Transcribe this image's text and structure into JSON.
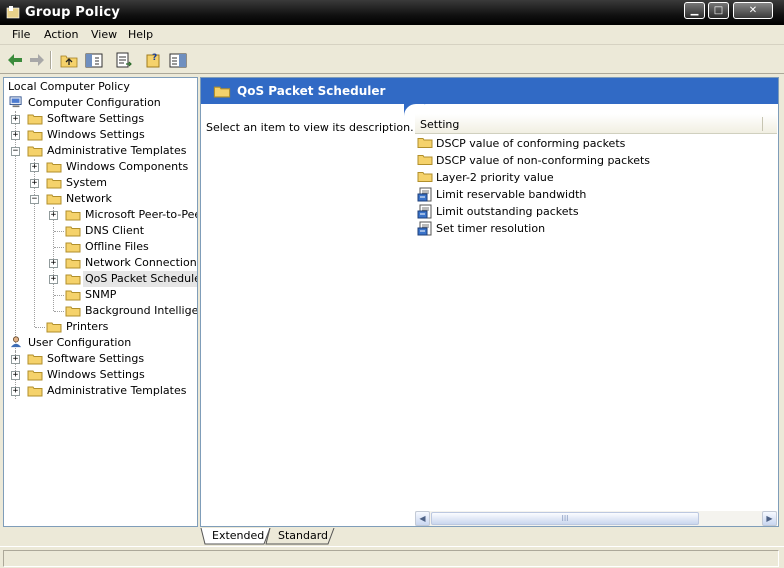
{
  "window": {
    "title": "Group Policy",
    "min_glyph": "▁",
    "max_glyph": "□",
    "close_glyph": "✕"
  },
  "menu": {
    "file": "File",
    "action": "Action",
    "view": "View",
    "help": "Help"
  },
  "tree": {
    "root": "Local Computer Policy",
    "computer_config": "Computer Configuration",
    "cc_software": "Software Settings",
    "cc_windows": "Windows Settings",
    "cc_admin": "Administrative Templates",
    "windows_components": "Windows Components",
    "system": "System",
    "network": "Network",
    "ms_peer": "Microsoft Peer-to-Peer",
    "dns_client": "DNS Client",
    "offline_files": "Offline Files",
    "network_connections": "Network Connections",
    "qos": "QoS Packet Scheduler",
    "snmp": "SNMP",
    "bits": "Background Intelligent",
    "printers": "Printers",
    "user_config": "User Configuration",
    "uc_software": "Software Settings",
    "uc_windows": "Windows Settings",
    "uc_admin": "Administrative Templates",
    "expand_glyph": "+",
    "collapse_glyph": "−"
  },
  "details": {
    "header_title": "QoS Packet Scheduler",
    "description": "Select an item to view its description.",
    "column_setting": "Setting",
    "items": [
      {
        "label": "DSCP value of conforming packets",
        "kind": "folder"
      },
      {
        "label": "DSCP value of non-conforming packets",
        "kind": "folder"
      },
      {
        "label": "Layer-2 priority value",
        "kind": "folder"
      },
      {
        "label": "Limit reservable bandwidth",
        "kind": "policy"
      },
      {
        "label": "Limit outstanding packets",
        "kind": "policy"
      },
      {
        "label": "Set timer resolution",
        "kind": "policy"
      }
    ]
  },
  "tabs": {
    "extended": "Extended",
    "standard": "Standard"
  },
  "scroll": {
    "left": "◀",
    "right": "▶",
    "grip": "III"
  },
  "colors": {
    "header_blue": "#316ac5",
    "folder": "#f5d26b",
    "titlebar": "#111111"
  }
}
